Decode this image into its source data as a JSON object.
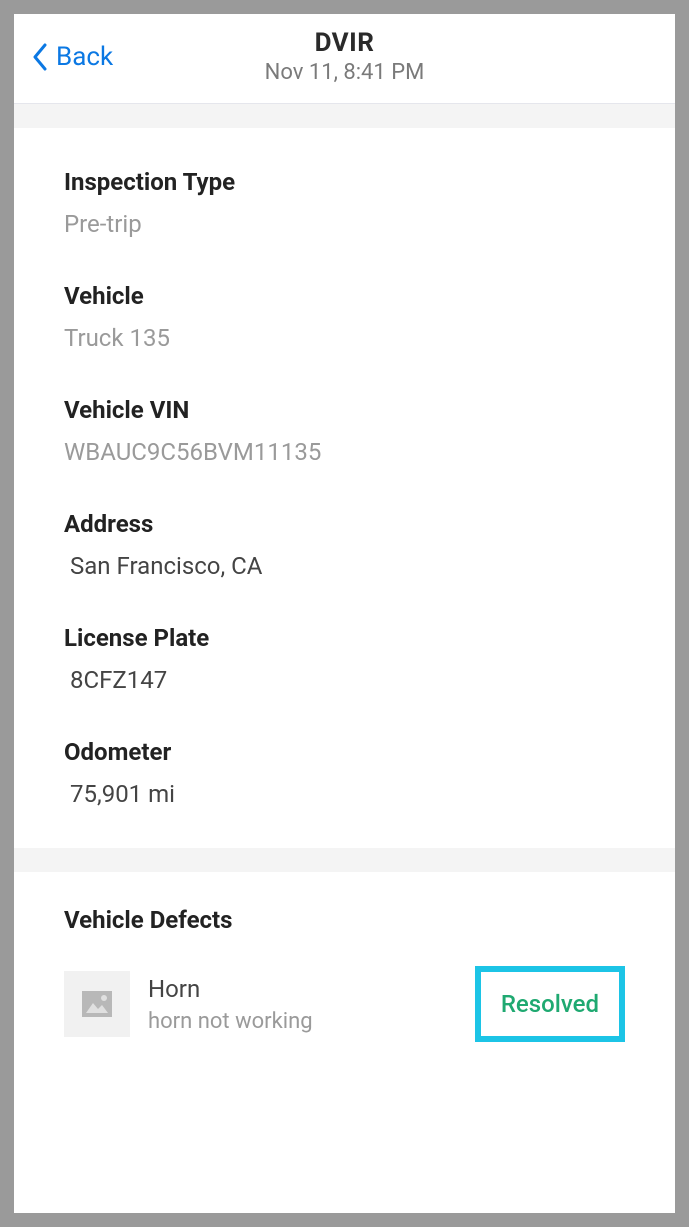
{
  "header": {
    "back_label": "Back",
    "title": "DVIR",
    "subtitle": "Nov 11, 8:41 PM"
  },
  "fields": {
    "inspection_type": {
      "label": "Inspection Type",
      "value": "Pre-trip"
    },
    "vehicle": {
      "label": "Vehicle",
      "value": "Truck 135"
    },
    "vin": {
      "label": "Vehicle VIN",
      "value": "WBAUC9C56BVM11135"
    },
    "address": {
      "label": "Address",
      "value": "San Francisco, CA"
    },
    "license_plate": {
      "label": "License Plate",
      "value": "8CFZ147"
    },
    "odometer": {
      "label": "Odometer",
      "value": "75,901 mi"
    }
  },
  "defects": {
    "section_title": "Vehicle Defects",
    "items": [
      {
        "name": "Horn",
        "description": "horn not working",
        "status": "Resolved"
      }
    ]
  }
}
